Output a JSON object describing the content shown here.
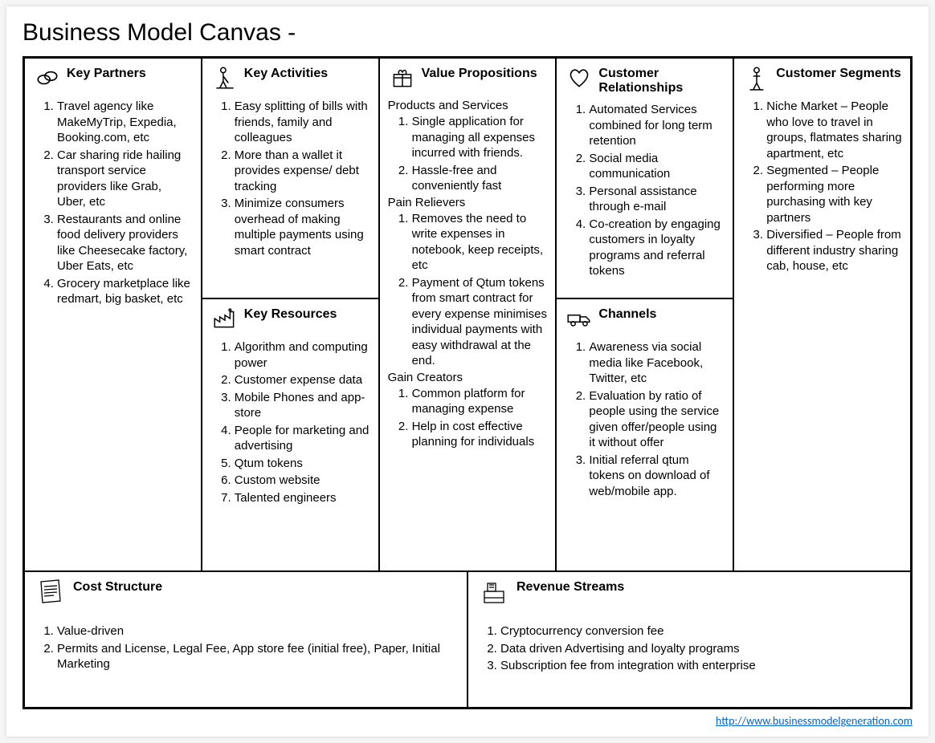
{
  "title": "Business Model Canvas -",
  "footer_link": "http://www.businessmodelgeneration.com",
  "sections": {
    "key_partners": {
      "label": "Key Partners",
      "items": [
        "Travel agency like MakeMyTrip, Expedia, Booking.com, etc",
        "Car sharing ride hailing transport service providers like Grab, Uber, etc",
        "Restaurants and online food delivery providers like Cheesecake factory, Uber Eats, etc",
        "Grocery marketplace like redmart, big basket, etc"
      ]
    },
    "key_activities": {
      "label": "Key Activities",
      "items": [
        "Easy splitting of bills with friends, family and colleagues",
        "More than a wallet it provides expense/ debt tracking",
        "Minimize consumers overhead of making multiple payments using smart contract"
      ]
    },
    "key_resources": {
      "label": "Key Resources",
      "items": [
        "Algorithm and computing power",
        "Customer expense data",
        "Mobile Phones and app-store",
        "People for marketing and advertising",
        "Qtum tokens",
        "Custom website",
        "Talented engineers"
      ]
    },
    "value_propositions": {
      "label": "Value Propositions",
      "products_heading": "Products and Services",
      "products": [
        "Single application for managing all expenses incurred with friends.",
        "Hassle-free and conveniently fast"
      ],
      "pain_heading": "Pain Relievers",
      "pain": [
        "Removes the need to write expenses in notebook, keep receipts, etc",
        "Payment of Qtum tokens from smart contract for every expense minimises individual payments with easy withdrawal at the end."
      ],
      "gain_heading": "Gain Creators",
      "gain": [
        "Common platform for managing expense",
        "Help in cost effective planning for individuals"
      ]
    },
    "customer_relationships": {
      "label": "Customer Relationships",
      "items": [
        "Automated Services combined for long term retention",
        "Social media communication",
        "Personal assistance through e-mail",
        "Co-creation by engaging customers in loyalty programs and referral tokens"
      ]
    },
    "channels": {
      "label": "Channels",
      "items": [
        "Awareness via social media like Facebook, Twitter, etc",
        "Evaluation by ratio of people using the service given offer/people using it without offer",
        "Initial referral qtum tokens on download of web/mobile app."
      ]
    },
    "customer_segments": {
      "label": "Customer Segments",
      "items": [
        "Niche Market – People who love to travel in groups, flatmates sharing apartment, etc",
        "Segmented – People performing more purchasing with key partners",
        "Diversified – People from different industry sharing cab, house, etc"
      ]
    },
    "cost_structure": {
      "label": "Cost Structure",
      "items": [
        "Value-driven",
        "Permits and License, Legal Fee, App store fee (initial free), Paper, Initial Marketing"
      ]
    },
    "revenue_streams": {
      "label": "Revenue Streams",
      "items": [
        "Cryptocurrency conversion fee",
        "Data driven Advertising and loyalty programs",
        "Subscription fee from integration with enterprise"
      ]
    }
  }
}
